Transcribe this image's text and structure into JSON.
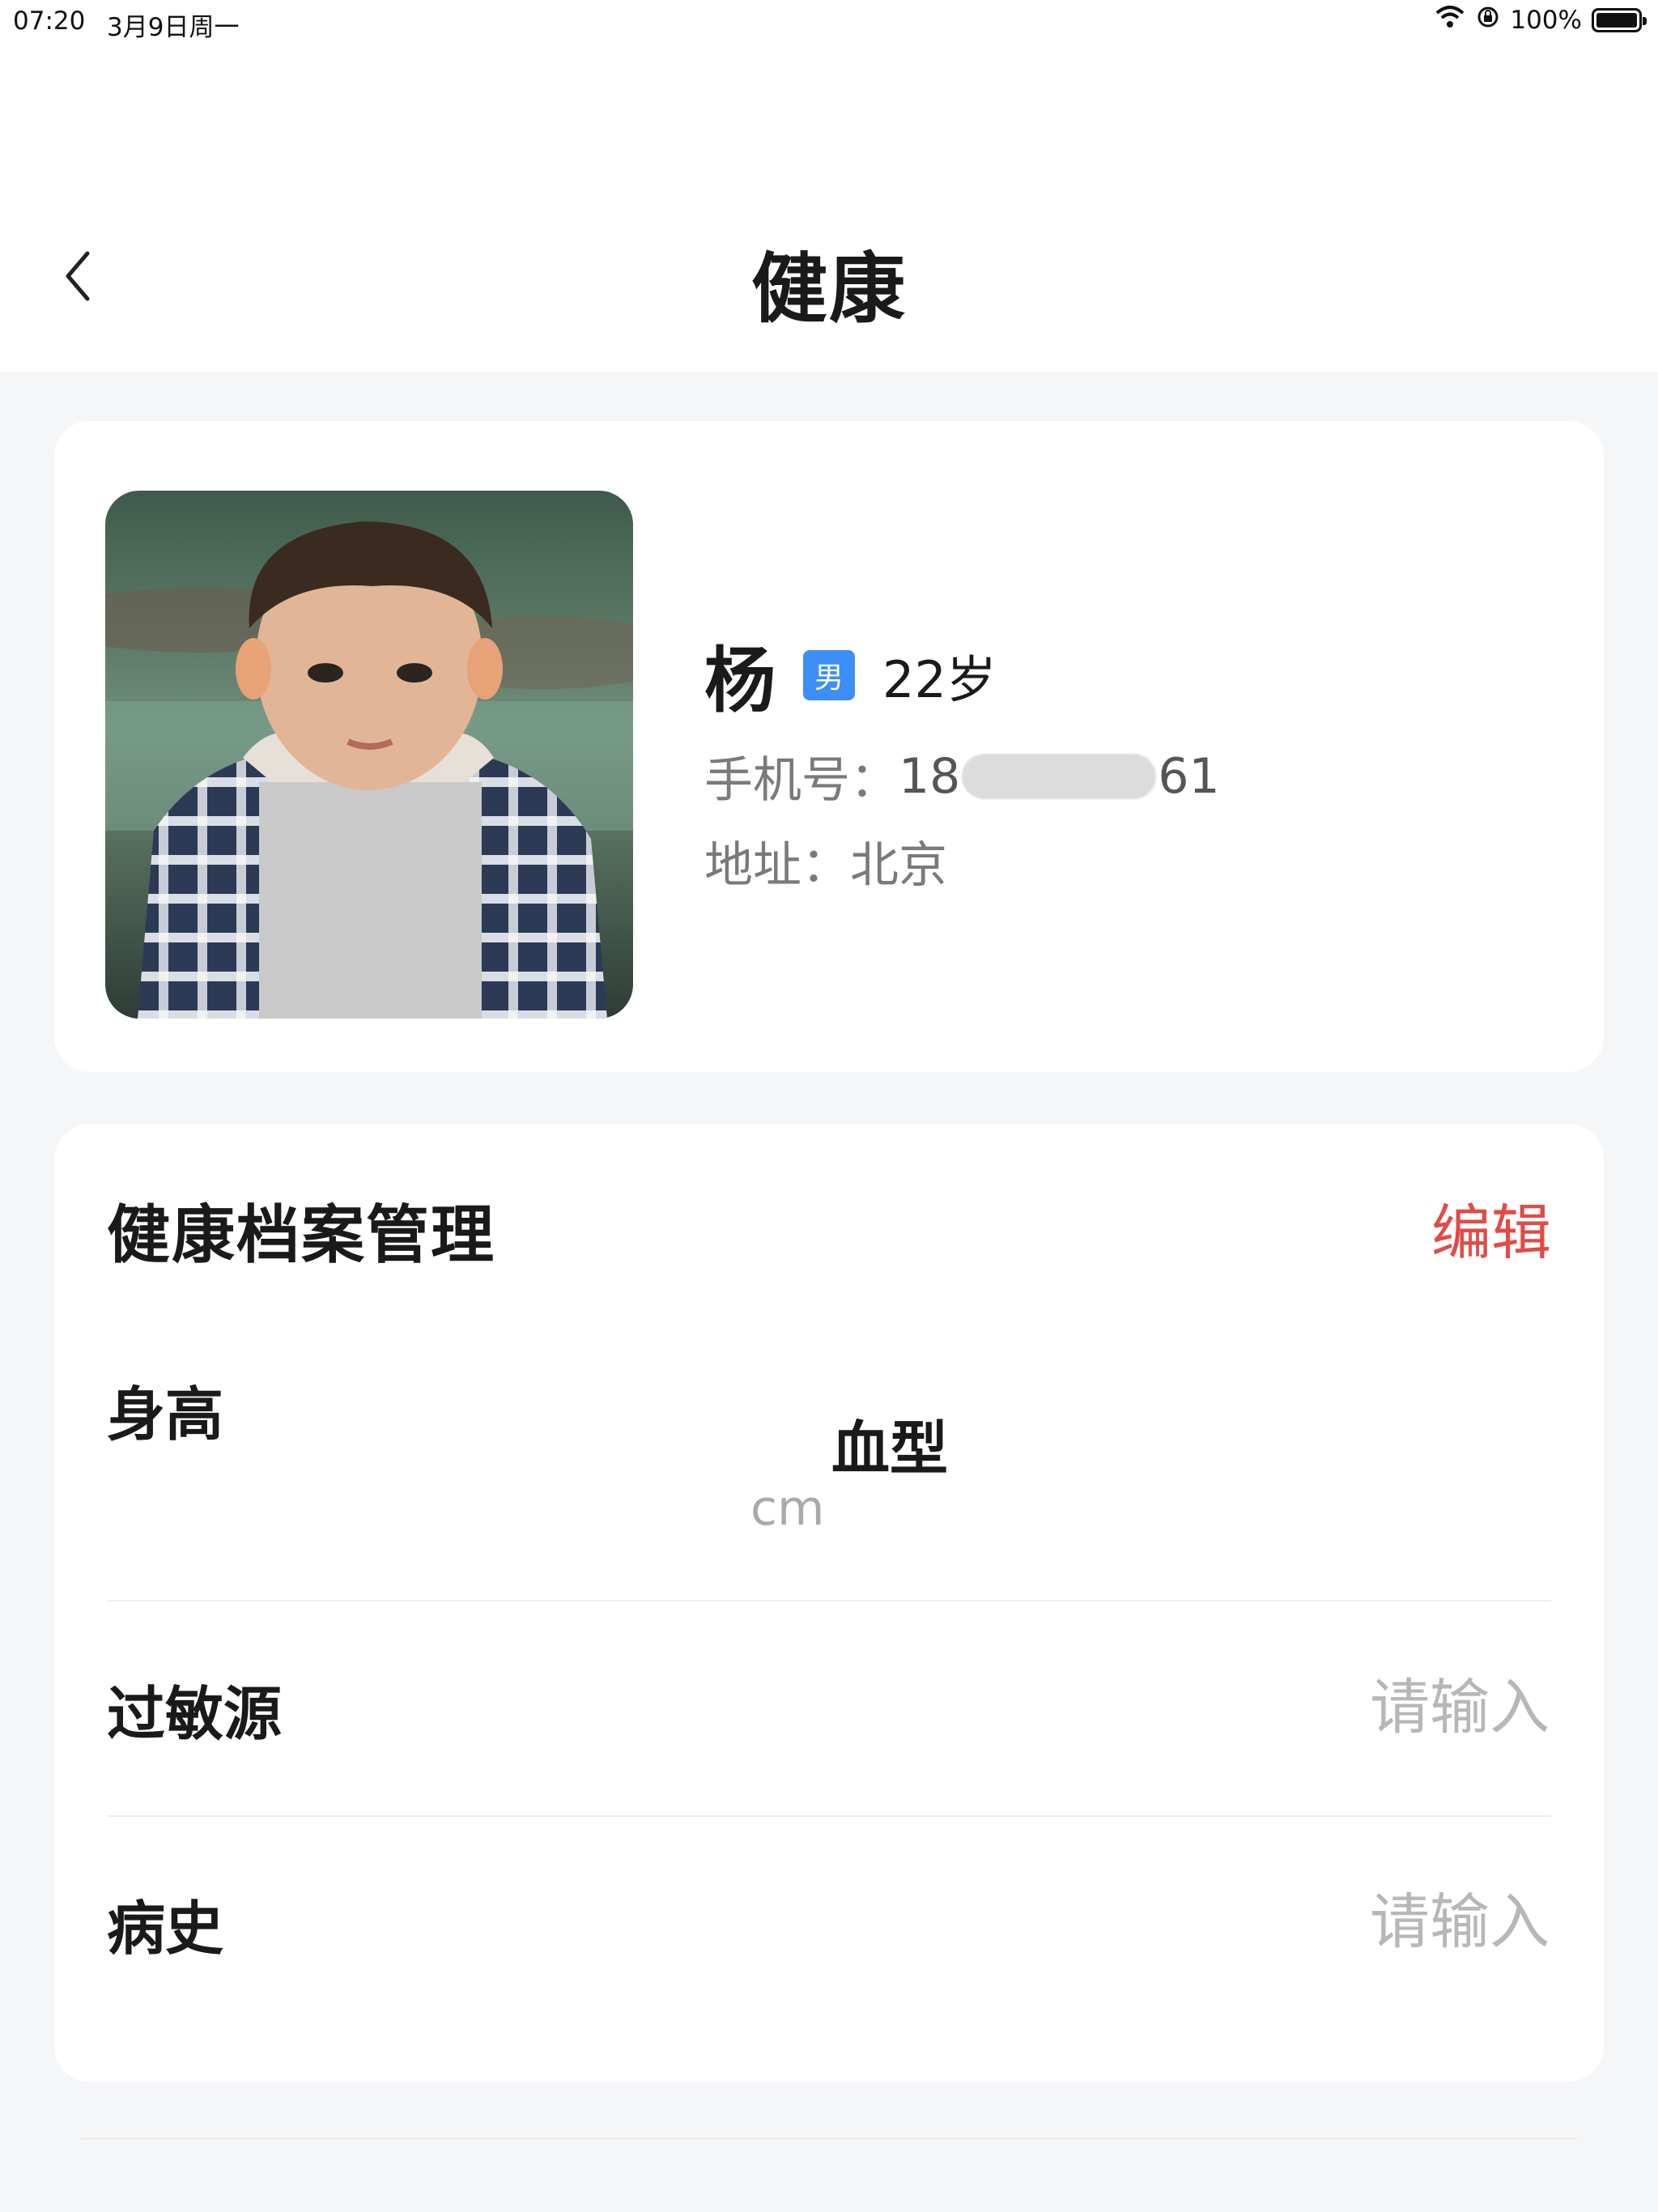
{
  "status_bar": {
    "time": "07:20",
    "date": "3月9日周一",
    "battery": "100%",
    "battery_level": 1.0,
    "icons": [
      "wifi-icon",
      "lock-rotation-icon",
      "battery-icon"
    ]
  },
  "nav": {
    "title": "健康",
    "back_icon": "chevron-left-icon"
  },
  "profile": {
    "name": "杨",
    "gender": "男",
    "age": "22岁",
    "phone_label": "手机号：",
    "phone_prefix": "18",
    "phone_suffix": "61",
    "address_label": "地址：",
    "address": "北京"
  },
  "health_records": {
    "title": "健康档案管理",
    "edit_label": "编辑",
    "height_label": "身高",
    "height_unit": "cm",
    "blood_type_label": "血型",
    "allergy_label": "过敏源",
    "allergy_placeholder": "请输入",
    "history_label": "病史",
    "history_placeholder": "请输入"
  },
  "colors": {
    "accent_red": "#e24a46",
    "badge_blue": "#3d8ef7",
    "background": "#f5f6f8"
  }
}
